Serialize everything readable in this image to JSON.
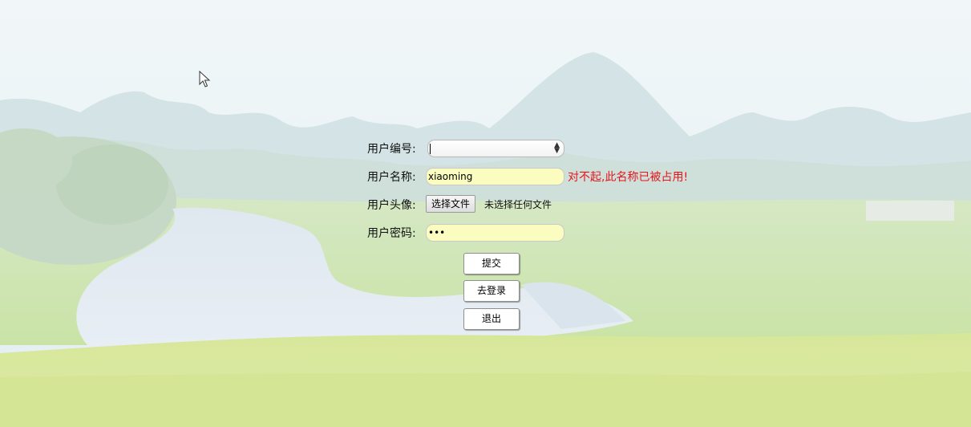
{
  "form": {
    "user_id": {
      "label": "用户编号:",
      "value": ""
    },
    "user_name": {
      "label": "用户名称:",
      "value": "xiaoming",
      "error": "对不起,此名称已被占用!"
    },
    "avatar": {
      "label": "用户头像:",
      "button_label": "选择文件",
      "status": "未选择任何文件"
    },
    "password": {
      "label": "用户密码:",
      "value": "•••"
    },
    "buttons": {
      "submit": "提交",
      "login": "去登录",
      "exit": "退出"
    }
  },
  "colors": {
    "error": "#e8141b",
    "input_autofill": "#fbfcc0"
  },
  "icons": {
    "cursor": "mouse-pointer-icon",
    "select_arrows": "select-arrows-icon"
  }
}
